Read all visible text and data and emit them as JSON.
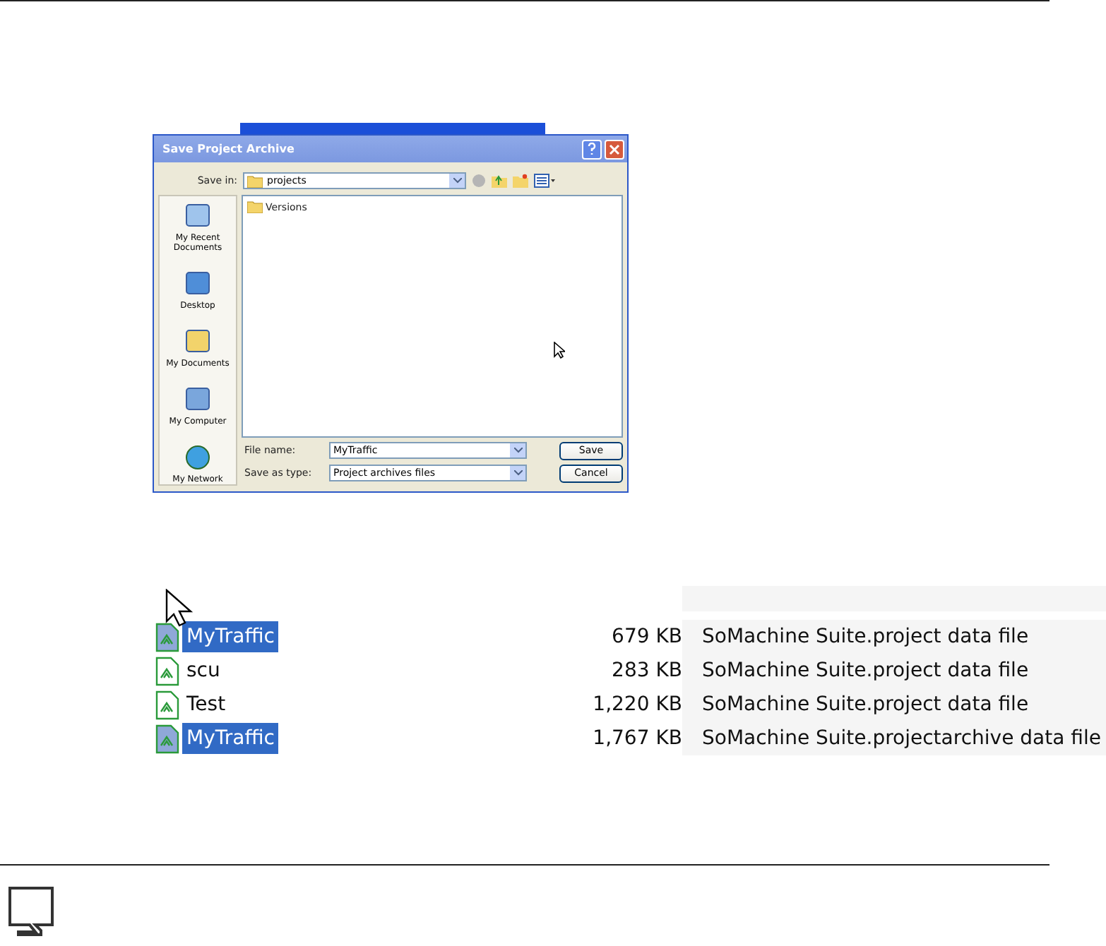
{
  "dialog": {
    "title": "Save Project Archive",
    "save_in_label": "Save in:",
    "save_in_value": "projects",
    "places": [
      {
        "label": "My Recent Documents"
      },
      {
        "label": "Desktop"
      },
      {
        "label": "My Documents"
      },
      {
        "label": "My Computer"
      },
      {
        "label": "My Network"
      }
    ],
    "files": [
      {
        "name": "Versions"
      }
    ],
    "file_name_label": "File name:",
    "file_name_value": "MyTraffic",
    "type_label": "Save as type:",
    "type_value": "Project archives files",
    "buttons": [
      "Save",
      "Cancel"
    ]
  },
  "file_list": {
    "rows": [
      {
        "name": "MyTraffic",
        "size": "679 KB",
        "type": "SoMachine Suite.project data file",
        "selected": true
      },
      {
        "name": "scu",
        "size": "283 KB",
        "type": "SoMachine Suite.project data file",
        "selected": false
      },
      {
        "name": "Test",
        "size": "1,220 KB",
        "type": "SoMachine Suite.project data file",
        "selected": false
      },
      {
        "name": "MyTraffic",
        "size": "1,767 KB",
        "type": "SoMachine Suite.projectarchive data file",
        "selected": true
      }
    ]
  }
}
